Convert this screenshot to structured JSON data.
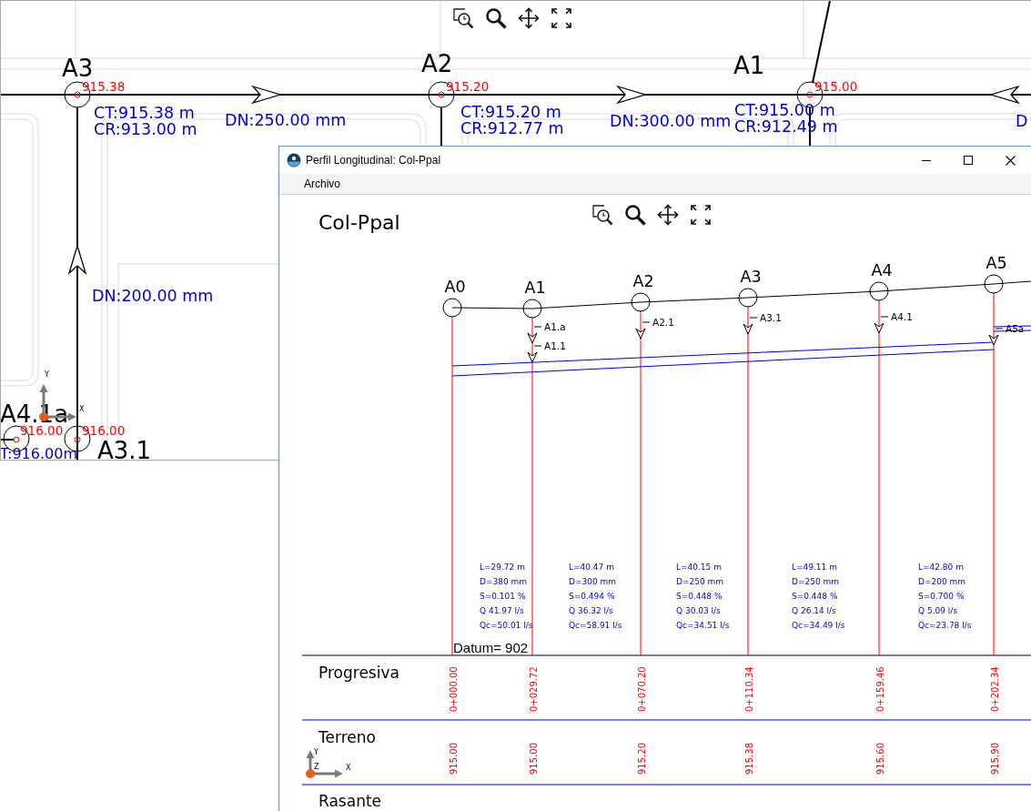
{
  "plan_view": {
    "nodes": [
      {
        "label": "A3",
        "elevation": "915.38",
        "cover": "CT:915.38 m",
        "invert": "CR:913.00 m"
      },
      {
        "label": "A2",
        "elevation": "915.20",
        "cover": "CT:915.20 m",
        "invert": "CR:912.77 m"
      },
      {
        "label": "A1",
        "elevation": "915.00",
        "cover": "CT:915.00 m",
        "invert": "CR:912.49 m"
      }
    ],
    "pipe_labels": [
      "DN:250.00 mm",
      "DN:300.00 mm",
      "DN:200.00 mm",
      "D"
    ],
    "lower_nodes": [
      {
        "label": "A4.1a",
        "elevation": "916.00",
        "cover": "T:916.00m"
      },
      {
        "label": "A3.1",
        "elevation": "916.00"
      }
    ],
    "axes": {
      "y": "Y",
      "x": "X"
    }
  },
  "profile_window": {
    "title": "Perfil Longitudinal: Col-Ppal",
    "menu": [
      "Archivo"
    ],
    "profile_title": "Col-Ppal",
    "nodes": [
      {
        "label": "A0"
      },
      {
        "label": "A1",
        "branches": [
          "A1.a",
          "A1.1"
        ]
      },
      {
        "label": "A2",
        "branches": [
          "A2.1"
        ]
      },
      {
        "label": "A3",
        "branches": [
          "A3.1"
        ]
      },
      {
        "label": "A4",
        "branches": [
          "A4.1"
        ]
      },
      {
        "label": "A5",
        "branches": [
          "A5a"
        ]
      }
    ],
    "segments": [
      {
        "length": "L=29.72 m",
        "diameter": "D=380 mm",
        "slope": "S=0.101 %",
        "flow": "Q 41.97 l/s",
        "capacity": "Qc=50.01 l/s"
      },
      {
        "length": "L=40.47 m",
        "diameter": "D=300 mm",
        "slope": "S=0.494 %",
        "flow": "Q 36.32 l/s",
        "capacity": "Qc=58.91 l/s"
      },
      {
        "length": "L=40.15 m",
        "diameter": "D=250 mm",
        "slope": "S=0.448 %",
        "flow": "Q 30.03 l/s",
        "capacity": "Qc=34.51 l/s"
      },
      {
        "length": "L=49.11 m",
        "diameter": "D=250 mm",
        "slope": "S=0.448 %",
        "flow": "Q 26.14 l/s",
        "capacity": "Qc=34.49 l/s"
      },
      {
        "length": "L=42.80 m",
        "diameter": "D=200 mm",
        "slope": "S=0.700 %",
        "flow": "Q 5.09 l/s",
        "capacity": "Qc=23.78 l/s"
      }
    ],
    "datum": "Datum= 902",
    "bands": [
      {
        "label": "Progresiva",
        "values": [
          "0+000.00",
          "0+029.72",
          "0+070.20",
          "0+110.34",
          "0+159.46",
          "0+202.34"
        ]
      },
      {
        "label": "Terreno",
        "values": [
          "915.00",
          "915.00",
          "915.20",
          "915.38",
          "915.60",
          "915.90"
        ]
      },
      {
        "label": "Rasante"
      }
    ],
    "axes": {
      "y": "Y",
      "z": "Z",
      "x": "X"
    }
  }
}
